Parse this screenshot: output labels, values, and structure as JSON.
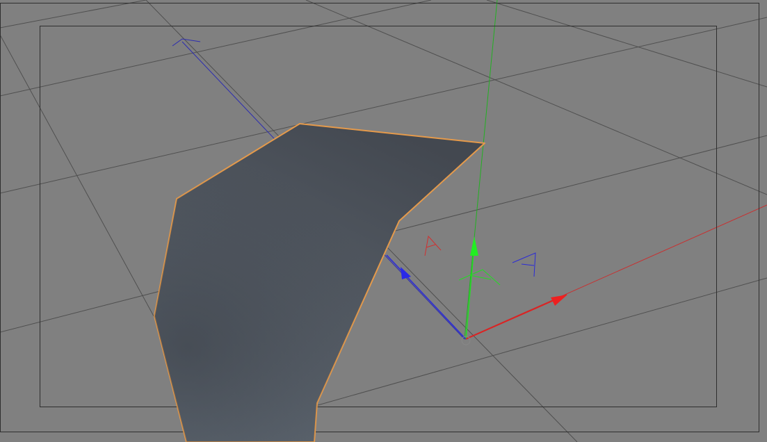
{
  "viewport": {
    "background_color": "#808080",
    "grid_color": "#4f4f4f",
    "frame_color": "#2e2e2e"
  },
  "object": {
    "fill_top": "#454a52",
    "fill_bottom": "#5e6670",
    "outline_color": "#e59a4b",
    "selected": true
  },
  "gizmo": {
    "x_axis_color": "#e02020",
    "y_axis_color": "#22dd22",
    "z_axis_color": "#2a2ad8",
    "x_axis_label": "",
    "y_axis_label": "",
    "z_axis_label": ""
  },
  "world_axes": {
    "x_color": "#c83030",
    "y_color": "#22b022",
    "z_color": "#2c2cb0"
  }
}
